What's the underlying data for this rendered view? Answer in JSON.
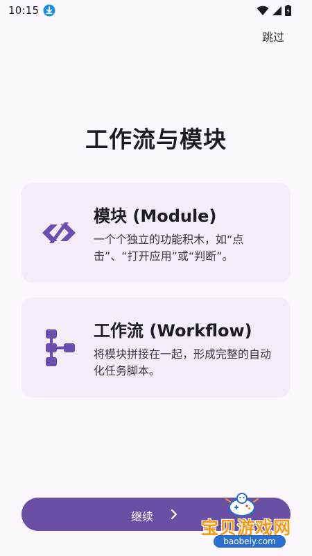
{
  "status_bar": {
    "time": "10:15",
    "icons": [
      "download-icon",
      "wifi-icon",
      "signal-icon",
      "battery-charging-icon"
    ]
  },
  "header": {
    "skip_label": "跳过"
  },
  "main": {
    "title": "工作流与模块",
    "cards": [
      {
        "icon": "code-brackets-icon",
        "title": "模块 (Module)",
        "description": "一个个独立的功能积木，如“点击”、“打开应用”或“判断”。"
      },
      {
        "icon": "workflow-nodes-icon",
        "title": "工作流 (Workflow)",
        "description": "将模块拼接在一起，形成完整的自动化任务脚本。"
      }
    ]
  },
  "footer": {
    "continue_label": "继续",
    "continue_icon": "chevron-right-icon"
  },
  "watermark": {
    "text": "宝贝游戏网",
    "url": "baobeiy.com"
  },
  "colors": {
    "background": "#fcf6fd",
    "card_background": "#f4edf8",
    "accent": "#6950a4",
    "icon_purple": "#6b4fb0"
  }
}
